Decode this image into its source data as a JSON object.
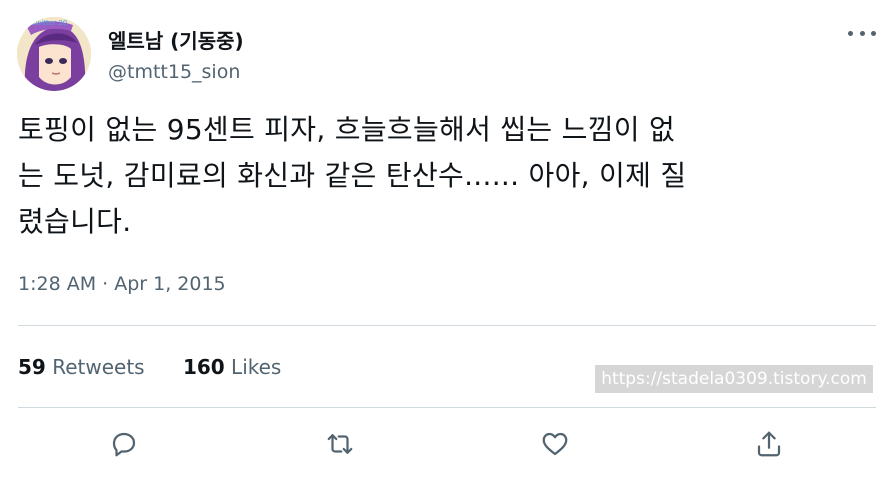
{
  "tweet": {
    "display_name": "엘트남 (기동중)",
    "handle": "@tmtt15_sion",
    "text": "토핑이 없는 95센트 피자, 흐늘흐늘해서 씹는 느낌이 없\n는 도넛, 감미료의 화신과 같은 탄산수...... 아아, 이제 질\n렸습니다.",
    "timestamp": "1:28 AM · Apr 1, 2015"
  },
  "stats": {
    "retweets_count": "59",
    "retweets_label": "Retweets",
    "likes_count": "160",
    "likes_label": "Likes"
  },
  "watermark": "https://stadela0309.tistory.com",
  "avatar_badge": "twitter 20",
  "icons": {
    "more": "more-options-icon",
    "reply": "reply-icon",
    "retweet": "retweet-icon",
    "like": "heart-icon",
    "share": "share-icon"
  },
  "colors": {
    "text": "#0f1419",
    "secondary": "#536471",
    "divider": "#cfd9de",
    "avatar_hair": "#7b3fa0"
  }
}
